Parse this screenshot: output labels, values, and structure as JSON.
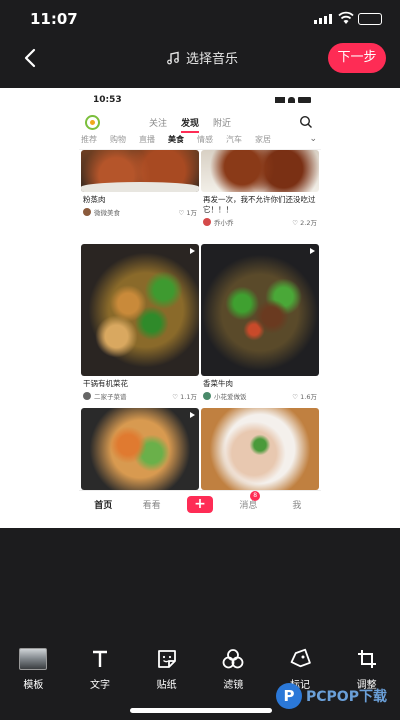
{
  "status_bar": {
    "time": "11:07"
  },
  "header": {
    "music_label": "选择音乐",
    "next_label": "下一步"
  },
  "phone": {
    "status_time": "10:53",
    "tabs": [
      {
        "label": "关注",
        "active": false
      },
      {
        "label": "发现",
        "active": true
      },
      {
        "label": "附近",
        "active": false
      }
    ],
    "categories": [
      {
        "label": "推荐",
        "active": false
      },
      {
        "label": "购物",
        "active": false
      },
      {
        "label": "直播",
        "active": false
      },
      {
        "label": "美食",
        "active": true
      },
      {
        "label": "情感",
        "active": false
      },
      {
        "label": "汽车",
        "active": false
      },
      {
        "label": "家居",
        "active": false
      }
    ],
    "cards": [
      {
        "title": "粉蒸肉",
        "author": "微微美食",
        "likes": "1万",
        "avatar_color": "#8a5a3c",
        "img": "meat"
      },
      {
        "title": "再发一次，我不允许你们还没吃过它！！！",
        "author": "乔小乔",
        "likes": "2.2万",
        "avatar_color": "#d44a4a",
        "img": "chicken"
      },
      {
        "title": "干锅有机菜花",
        "author": "二家子菜谱",
        "likes": "1.1万",
        "avatar_color": "#666666",
        "img": "cauliflower"
      },
      {
        "title": "香菜牛肉",
        "author": "小花爱做饭",
        "likes": "1.6万",
        "avatar_color": "#4a8a6a",
        "img": "beef"
      },
      {
        "title": "",
        "author": "",
        "likes": "",
        "avatar_color": "#ffffff",
        "img": "salad"
      },
      {
        "title": "",
        "author": "",
        "likes": "",
        "avatar_color": "#ffffff",
        "img": "fish"
      }
    ],
    "nav": {
      "home": "首页",
      "watch": "看看",
      "plus": "+",
      "messages": "消息",
      "messages_badge": "8",
      "me": "我"
    }
  },
  "toolbar": [
    {
      "label": "模板",
      "icon": "template-thumbnail"
    },
    {
      "label": "文字",
      "icon": "text-icon"
    },
    {
      "label": "贴纸",
      "icon": "sticker-icon"
    },
    {
      "label": "滤镜",
      "icon": "filter-icon"
    },
    {
      "label": "标记",
      "icon": "tag-icon"
    },
    {
      "label": "调整",
      "icon": "crop-icon"
    }
  ],
  "watermark": {
    "letter": "P",
    "text": "PCPOP下载"
  },
  "colors": {
    "accent": "#fe2c55",
    "background": "#1c1c1e",
    "battery": "#34c759"
  }
}
